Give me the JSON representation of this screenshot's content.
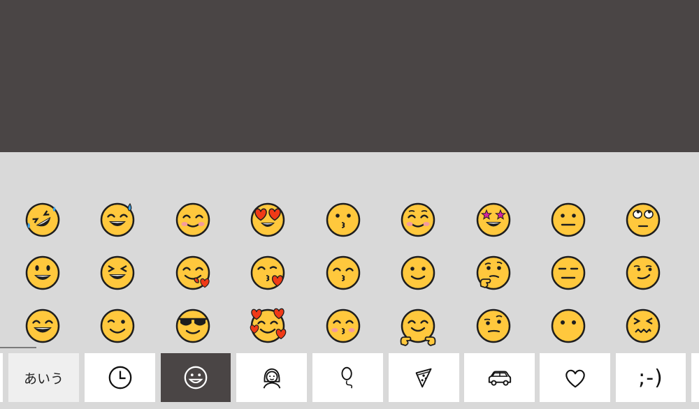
{
  "emoji_rows": [
    [
      "rolling-on-floor-laughing",
      "grinning-sweat",
      "smiling-eyes",
      "heart-eyes",
      "kissing",
      "blushing",
      "star-struck",
      "neutral",
      "eye-roll"
    ],
    [
      "grinning",
      "squinting-laugh",
      "yum",
      "blowing-kiss",
      "kissing-smiling-eyes",
      "slight-smile",
      "thinking",
      "expressionless",
      "smirk"
    ],
    [
      "beaming",
      "winking",
      "sunglasses",
      "smiling-hearts",
      "kissing-blush",
      "hugging",
      "raised-eyebrow",
      "no-mouth",
      "persevering"
    ]
  ],
  "colors": {
    "face": "#ffc83d",
    "outline": "#1e1e1e",
    "heart": "#f03a17",
    "blush": "#f59b9b",
    "star": "#d6249f",
    "sweat": "#3aa0e8",
    "tear": "#3aa0e8",
    "topbar": "#4a4545",
    "panel": "#d9d9d9",
    "tab_bg": "#ffffff",
    "tab_active": "#4a4545"
  },
  "tabs": [
    {
      "key": "kana",
      "label": "あいう"
    },
    {
      "key": "recent",
      "icon": "clock-icon"
    },
    {
      "key": "smileys",
      "icon": "smiley-icon",
      "active": true
    },
    {
      "key": "people",
      "icon": "person-icon"
    },
    {
      "key": "celebration",
      "icon": "balloon-icon"
    },
    {
      "key": "food",
      "icon": "pizza-icon"
    },
    {
      "key": "travel",
      "icon": "car-icon"
    },
    {
      "key": "symbols",
      "icon": "heart-icon"
    },
    {
      "key": "kaomoji",
      "label": ";-)"
    }
  ]
}
